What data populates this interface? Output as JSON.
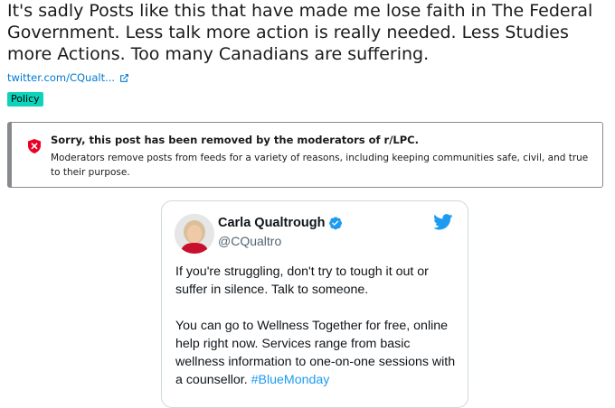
{
  "post": {
    "title": "It's sadly Posts like this that have made me lose faith in The Federal Government. Less talk more action is really needed. Less Studies more Actions. Too many Canadians are suffering.",
    "link_text": "twitter.com/CQualt...",
    "flair": "Policy",
    "flair_color": "#0dd3bb"
  },
  "removed_notice": {
    "heading": "Sorry, this post has been removed by the moderators of r/LPC.",
    "body": "Moderators remove posts from feeds for a variety of reasons, including keeping communities safe, civil, and true to their purpose.",
    "icon": "shield-x-icon",
    "icon_color": "#ea0027"
  },
  "tweet": {
    "author_name": "Carla Qualtrough",
    "author_handle": "@CQualtro",
    "verified_icon": "verified-badge-icon",
    "paragraph1": "If you're struggling, don't try to tough it out or suffer in silence. Talk to someone.",
    "paragraph2": "You can go to Wellness Together for free, online help right now. Services range from basic wellness information to one-on-one sessions with a counsellor.",
    "hashtag": "#BlueMonday",
    "accent_color": "#1d9bf0"
  }
}
